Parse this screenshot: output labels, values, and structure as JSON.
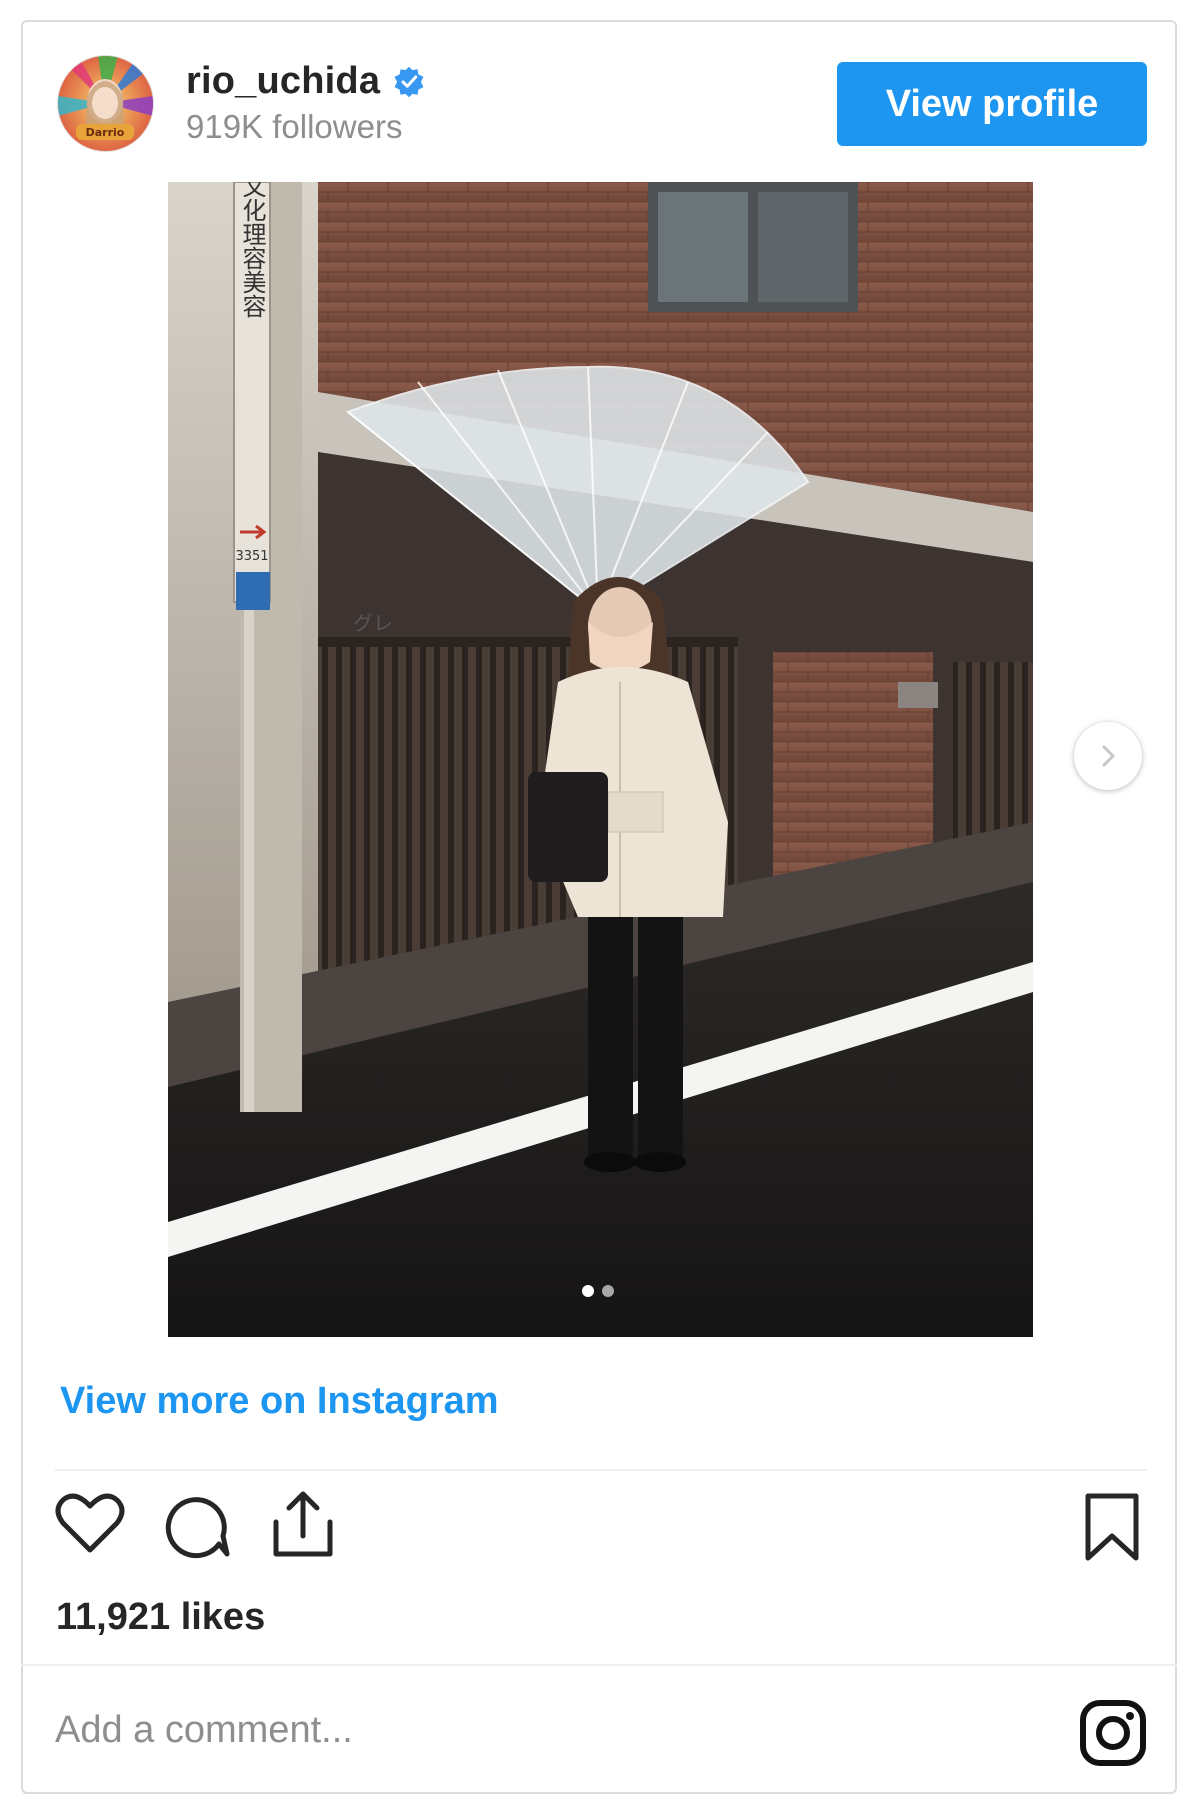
{
  "header": {
    "username": "rio_uchida",
    "followers": "919K followers",
    "view_profile_label": "View profile",
    "avatar_text": "Darrio"
  },
  "photo": {
    "sign_text": "国際文化理容美容",
    "sign_number": "3351",
    "gate_sign": "グレ",
    "carousel": {
      "total": 2,
      "current": 1
    }
  },
  "links": {
    "view_more": "View more on Instagram"
  },
  "actions": {
    "icons": [
      "heart-icon",
      "comment-icon",
      "share-icon",
      "bookmark-icon"
    ]
  },
  "likes_text": "11,921 likes",
  "comment": {
    "placeholder": "Add a comment..."
  },
  "colors": {
    "accent": "#1c96f0",
    "text": "#262626",
    "muted": "#8e8e8e",
    "divider": "#efefef"
  }
}
